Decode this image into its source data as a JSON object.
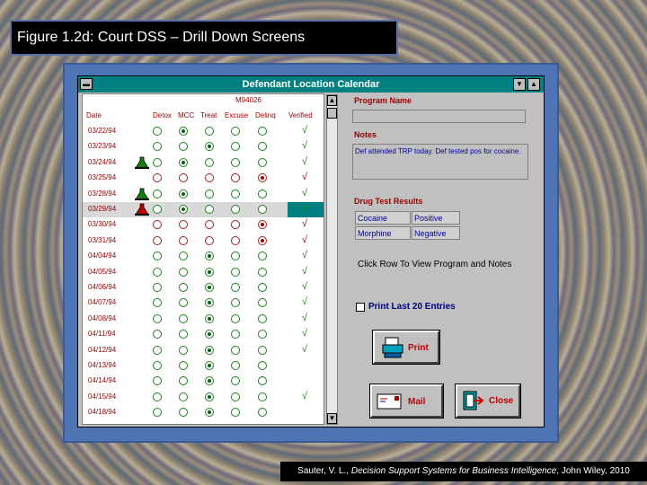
{
  "slide": {
    "title": "Figure 1.2d:  Court DSS – Drill Down Screens",
    "credit_pre": "Sauter, V. L., ",
    "credit_title": "Decision Support Systems for Business Intelligence",
    "credit_post": ", John Wiley, 2010"
  },
  "window": {
    "title": "Defendant Location Calendar",
    "system_menu_icon": "minus-bar-icon"
  },
  "calendar": {
    "case_id": "M94026",
    "headers": [
      "Date",
      "Detox",
      "MCC",
      "Treat",
      "Excuse",
      "Delinq",
      "Verified"
    ],
    "rows": [
      {
        "date": "03/22/94",
        "flask": "",
        "sel": [
          0,
          1,
          0,
          0,
          0
        ],
        "color": "grn",
        "verified": "√"
      },
      {
        "date": "03/23/94",
        "flask": "",
        "sel": [
          0,
          0,
          1,
          0,
          0
        ],
        "color": "grn",
        "verified": "√"
      },
      {
        "date": "03/24/94",
        "flask": "green",
        "sel": [
          0,
          1,
          0,
          0,
          0
        ],
        "color": "grn",
        "verified": "√"
      },
      {
        "date": "03/25/94",
        "flask": "",
        "sel": [
          0,
          0,
          0,
          0,
          1
        ],
        "color": "red",
        "verified": "√"
      },
      {
        "date": "03/28/94",
        "flask": "green",
        "sel": [
          0,
          1,
          0,
          0,
          0
        ],
        "color": "grn",
        "verified": "√"
      },
      {
        "date": "03/29/94",
        "flask": "red",
        "sel": [
          0,
          1,
          0,
          0,
          0
        ],
        "color": "grn",
        "verified": "√",
        "selected": true
      },
      {
        "date": "03/30/94",
        "flask": "",
        "sel": [
          0,
          0,
          0,
          0,
          1
        ],
        "color": "red",
        "verified": "√"
      },
      {
        "date": "03/31/94",
        "flask": "",
        "sel": [
          0,
          0,
          0,
          0,
          1
        ],
        "color": "red",
        "verified": "√"
      },
      {
        "date": "04/04/94",
        "flask": "",
        "sel": [
          0,
          0,
          1,
          0,
          0
        ],
        "color": "grn",
        "verified": "√"
      },
      {
        "date": "04/05/94",
        "flask": "",
        "sel": [
          0,
          0,
          1,
          0,
          0
        ],
        "color": "grn",
        "verified": "√"
      },
      {
        "date": "04/06/94",
        "flask": "",
        "sel": [
          0,
          0,
          1,
          0,
          0
        ],
        "color": "grn",
        "verified": "√"
      },
      {
        "date": "04/07/94",
        "flask": "",
        "sel": [
          0,
          0,
          1,
          0,
          0
        ],
        "color": "grn",
        "verified": "√"
      },
      {
        "date": "04/08/94",
        "flask": "",
        "sel": [
          0,
          0,
          1,
          0,
          0
        ],
        "color": "grn",
        "verified": "√"
      },
      {
        "date": "04/11/94",
        "flask": "",
        "sel": [
          0,
          0,
          1,
          0,
          0
        ],
        "color": "grn",
        "verified": "√"
      },
      {
        "date": "04/12/94",
        "flask": "",
        "sel": [
          0,
          0,
          1,
          0,
          0
        ],
        "color": "grn",
        "verified": "√"
      },
      {
        "date": "04/13/94",
        "flask": "",
        "sel": [
          0,
          0,
          1,
          0,
          0
        ],
        "color": "grn",
        "verified": ""
      },
      {
        "date": "04/14/94",
        "flask": "",
        "sel": [
          0,
          0,
          1,
          0,
          0
        ],
        "color": "grn",
        "verified": ""
      },
      {
        "date": "04/15/94",
        "flask": "",
        "sel": [
          0,
          0,
          1,
          0,
          0
        ],
        "color": "grn",
        "verified": "√"
      },
      {
        "date": "04/18/94",
        "flask": "",
        "sel": [
          0,
          0,
          1,
          0,
          0
        ],
        "color": "grn",
        "verified": ""
      }
    ]
  },
  "details": {
    "program_name_label": "Program Name",
    "program_name_value": "",
    "notes_label": "Notes",
    "notes_text": "Def attended TRP today. Def tested pos for cocaine.",
    "drug_test_label": "Drug Test Results",
    "drug_tests": [
      {
        "drug": "Cocaine",
        "result": "Positive"
      },
      {
        "drug": "Morphine",
        "result": "Negative"
      }
    ],
    "hint": "Click Row To View Program and Notes",
    "print_last_label": "Print Last 20 Entries",
    "print_last_checked": false
  },
  "buttons": {
    "print": "Print",
    "mail": "Mail",
    "close": "Close"
  },
  "colors": {
    "title_bar": "#008080",
    "label_red": "#a00000",
    "value_blue": "#0000a0",
    "frame_blue": "#4e74b6"
  }
}
